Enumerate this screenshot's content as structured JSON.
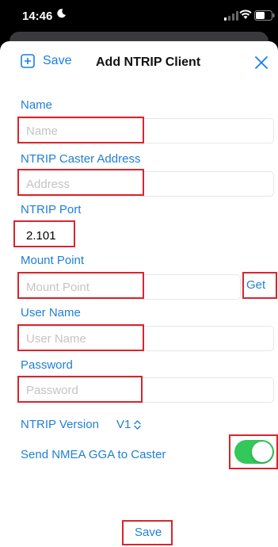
{
  "status": {
    "time": "14:46"
  },
  "nav": {
    "save_label": "Save",
    "title": "Add NTRIP Client"
  },
  "fields": {
    "name": {
      "label": "Name",
      "placeholder": "Name",
      "value": ""
    },
    "address": {
      "label": "NTRIP Caster Address",
      "placeholder": "Address",
      "value": ""
    },
    "port": {
      "label": "NTRIP Port",
      "placeholder": "",
      "value": "2.101"
    },
    "mount": {
      "label": "Mount Point",
      "placeholder": "Mount Point",
      "value": "",
      "get_label": "Get"
    },
    "username": {
      "label": "User Name",
      "placeholder": "User Name",
      "value": ""
    },
    "password": {
      "label": "Password",
      "placeholder": "Password",
      "value": ""
    }
  },
  "version": {
    "label": "NTRIP Version",
    "value": "V1"
  },
  "gga": {
    "label": "Send NMEA GGA to Caster",
    "enabled": true
  },
  "footer": {
    "save_label": "Save"
  },
  "colors": {
    "accent": "#1f7fd6",
    "toggle_on": "#34c759",
    "highlight": "#d9252d"
  }
}
